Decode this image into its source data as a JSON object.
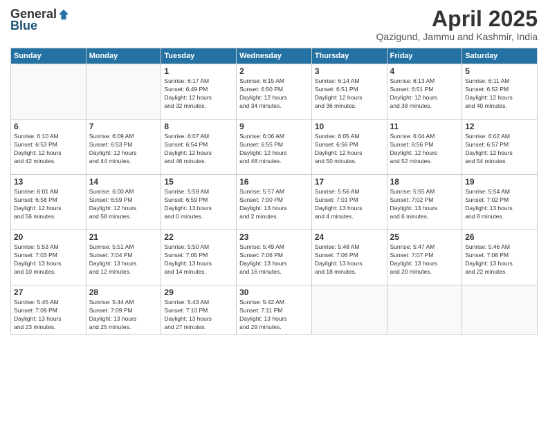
{
  "header": {
    "logo_general": "General",
    "logo_blue": "Blue",
    "title": "April 2025",
    "location": "Qazigund, Jammu and Kashmir, India"
  },
  "weekdays": [
    "Sunday",
    "Monday",
    "Tuesday",
    "Wednesday",
    "Thursday",
    "Friday",
    "Saturday"
  ],
  "weeks": [
    [
      {
        "day": "",
        "info": ""
      },
      {
        "day": "",
        "info": ""
      },
      {
        "day": "1",
        "info": "Sunrise: 6:17 AM\nSunset: 6:49 PM\nDaylight: 12 hours\nand 32 minutes."
      },
      {
        "day": "2",
        "info": "Sunrise: 6:15 AM\nSunset: 6:50 PM\nDaylight: 12 hours\nand 34 minutes."
      },
      {
        "day": "3",
        "info": "Sunrise: 6:14 AM\nSunset: 6:51 PM\nDaylight: 12 hours\nand 36 minutes."
      },
      {
        "day": "4",
        "info": "Sunrise: 6:13 AM\nSunset: 6:51 PM\nDaylight: 12 hours\nand 38 minutes."
      },
      {
        "day": "5",
        "info": "Sunrise: 6:11 AM\nSunset: 6:52 PM\nDaylight: 12 hours\nand 40 minutes."
      }
    ],
    [
      {
        "day": "6",
        "info": "Sunrise: 6:10 AM\nSunset: 6:53 PM\nDaylight: 12 hours\nand 42 minutes."
      },
      {
        "day": "7",
        "info": "Sunrise: 6:09 AM\nSunset: 6:53 PM\nDaylight: 12 hours\nand 44 minutes."
      },
      {
        "day": "8",
        "info": "Sunrise: 6:07 AM\nSunset: 6:54 PM\nDaylight: 12 hours\nand 46 minutes."
      },
      {
        "day": "9",
        "info": "Sunrise: 6:06 AM\nSunset: 6:55 PM\nDaylight: 12 hours\nand 48 minutes."
      },
      {
        "day": "10",
        "info": "Sunrise: 6:05 AM\nSunset: 6:56 PM\nDaylight: 12 hours\nand 50 minutes."
      },
      {
        "day": "11",
        "info": "Sunrise: 6:04 AM\nSunset: 6:56 PM\nDaylight: 12 hours\nand 52 minutes."
      },
      {
        "day": "12",
        "info": "Sunrise: 6:02 AM\nSunset: 6:57 PM\nDaylight: 12 hours\nand 54 minutes."
      }
    ],
    [
      {
        "day": "13",
        "info": "Sunrise: 6:01 AM\nSunset: 6:58 PM\nDaylight: 12 hours\nand 56 minutes."
      },
      {
        "day": "14",
        "info": "Sunrise: 6:00 AM\nSunset: 6:59 PM\nDaylight: 12 hours\nand 58 minutes."
      },
      {
        "day": "15",
        "info": "Sunrise: 5:59 AM\nSunset: 6:59 PM\nDaylight: 13 hours\nand 0 minutes."
      },
      {
        "day": "16",
        "info": "Sunrise: 5:57 AM\nSunset: 7:00 PM\nDaylight: 13 hours\nand 2 minutes."
      },
      {
        "day": "17",
        "info": "Sunrise: 5:56 AM\nSunset: 7:01 PM\nDaylight: 13 hours\nand 4 minutes."
      },
      {
        "day": "18",
        "info": "Sunrise: 5:55 AM\nSunset: 7:02 PM\nDaylight: 13 hours\nand 6 minutes."
      },
      {
        "day": "19",
        "info": "Sunrise: 5:54 AM\nSunset: 7:02 PM\nDaylight: 13 hours\nand 8 minutes."
      }
    ],
    [
      {
        "day": "20",
        "info": "Sunrise: 5:53 AM\nSunset: 7:03 PM\nDaylight: 13 hours\nand 10 minutes."
      },
      {
        "day": "21",
        "info": "Sunrise: 5:51 AM\nSunset: 7:04 PM\nDaylight: 13 hours\nand 12 minutes."
      },
      {
        "day": "22",
        "info": "Sunrise: 5:50 AM\nSunset: 7:05 PM\nDaylight: 13 hours\nand 14 minutes."
      },
      {
        "day": "23",
        "info": "Sunrise: 5:49 AM\nSunset: 7:06 PM\nDaylight: 13 hours\nand 16 minutes."
      },
      {
        "day": "24",
        "info": "Sunrise: 5:48 AM\nSunset: 7:06 PM\nDaylight: 13 hours\nand 18 minutes."
      },
      {
        "day": "25",
        "info": "Sunrise: 5:47 AM\nSunset: 7:07 PM\nDaylight: 13 hours\nand 20 minutes."
      },
      {
        "day": "26",
        "info": "Sunrise: 5:46 AM\nSunset: 7:08 PM\nDaylight: 13 hours\nand 22 minutes."
      }
    ],
    [
      {
        "day": "27",
        "info": "Sunrise: 5:45 AM\nSunset: 7:09 PM\nDaylight: 13 hours\nand 23 minutes."
      },
      {
        "day": "28",
        "info": "Sunrise: 5:44 AM\nSunset: 7:09 PM\nDaylight: 13 hours\nand 25 minutes."
      },
      {
        "day": "29",
        "info": "Sunrise: 5:43 AM\nSunset: 7:10 PM\nDaylight: 13 hours\nand 27 minutes."
      },
      {
        "day": "30",
        "info": "Sunrise: 5:42 AM\nSunset: 7:11 PM\nDaylight: 13 hours\nand 29 minutes."
      },
      {
        "day": "",
        "info": ""
      },
      {
        "day": "",
        "info": ""
      },
      {
        "day": "",
        "info": ""
      }
    ]
  ]
}
